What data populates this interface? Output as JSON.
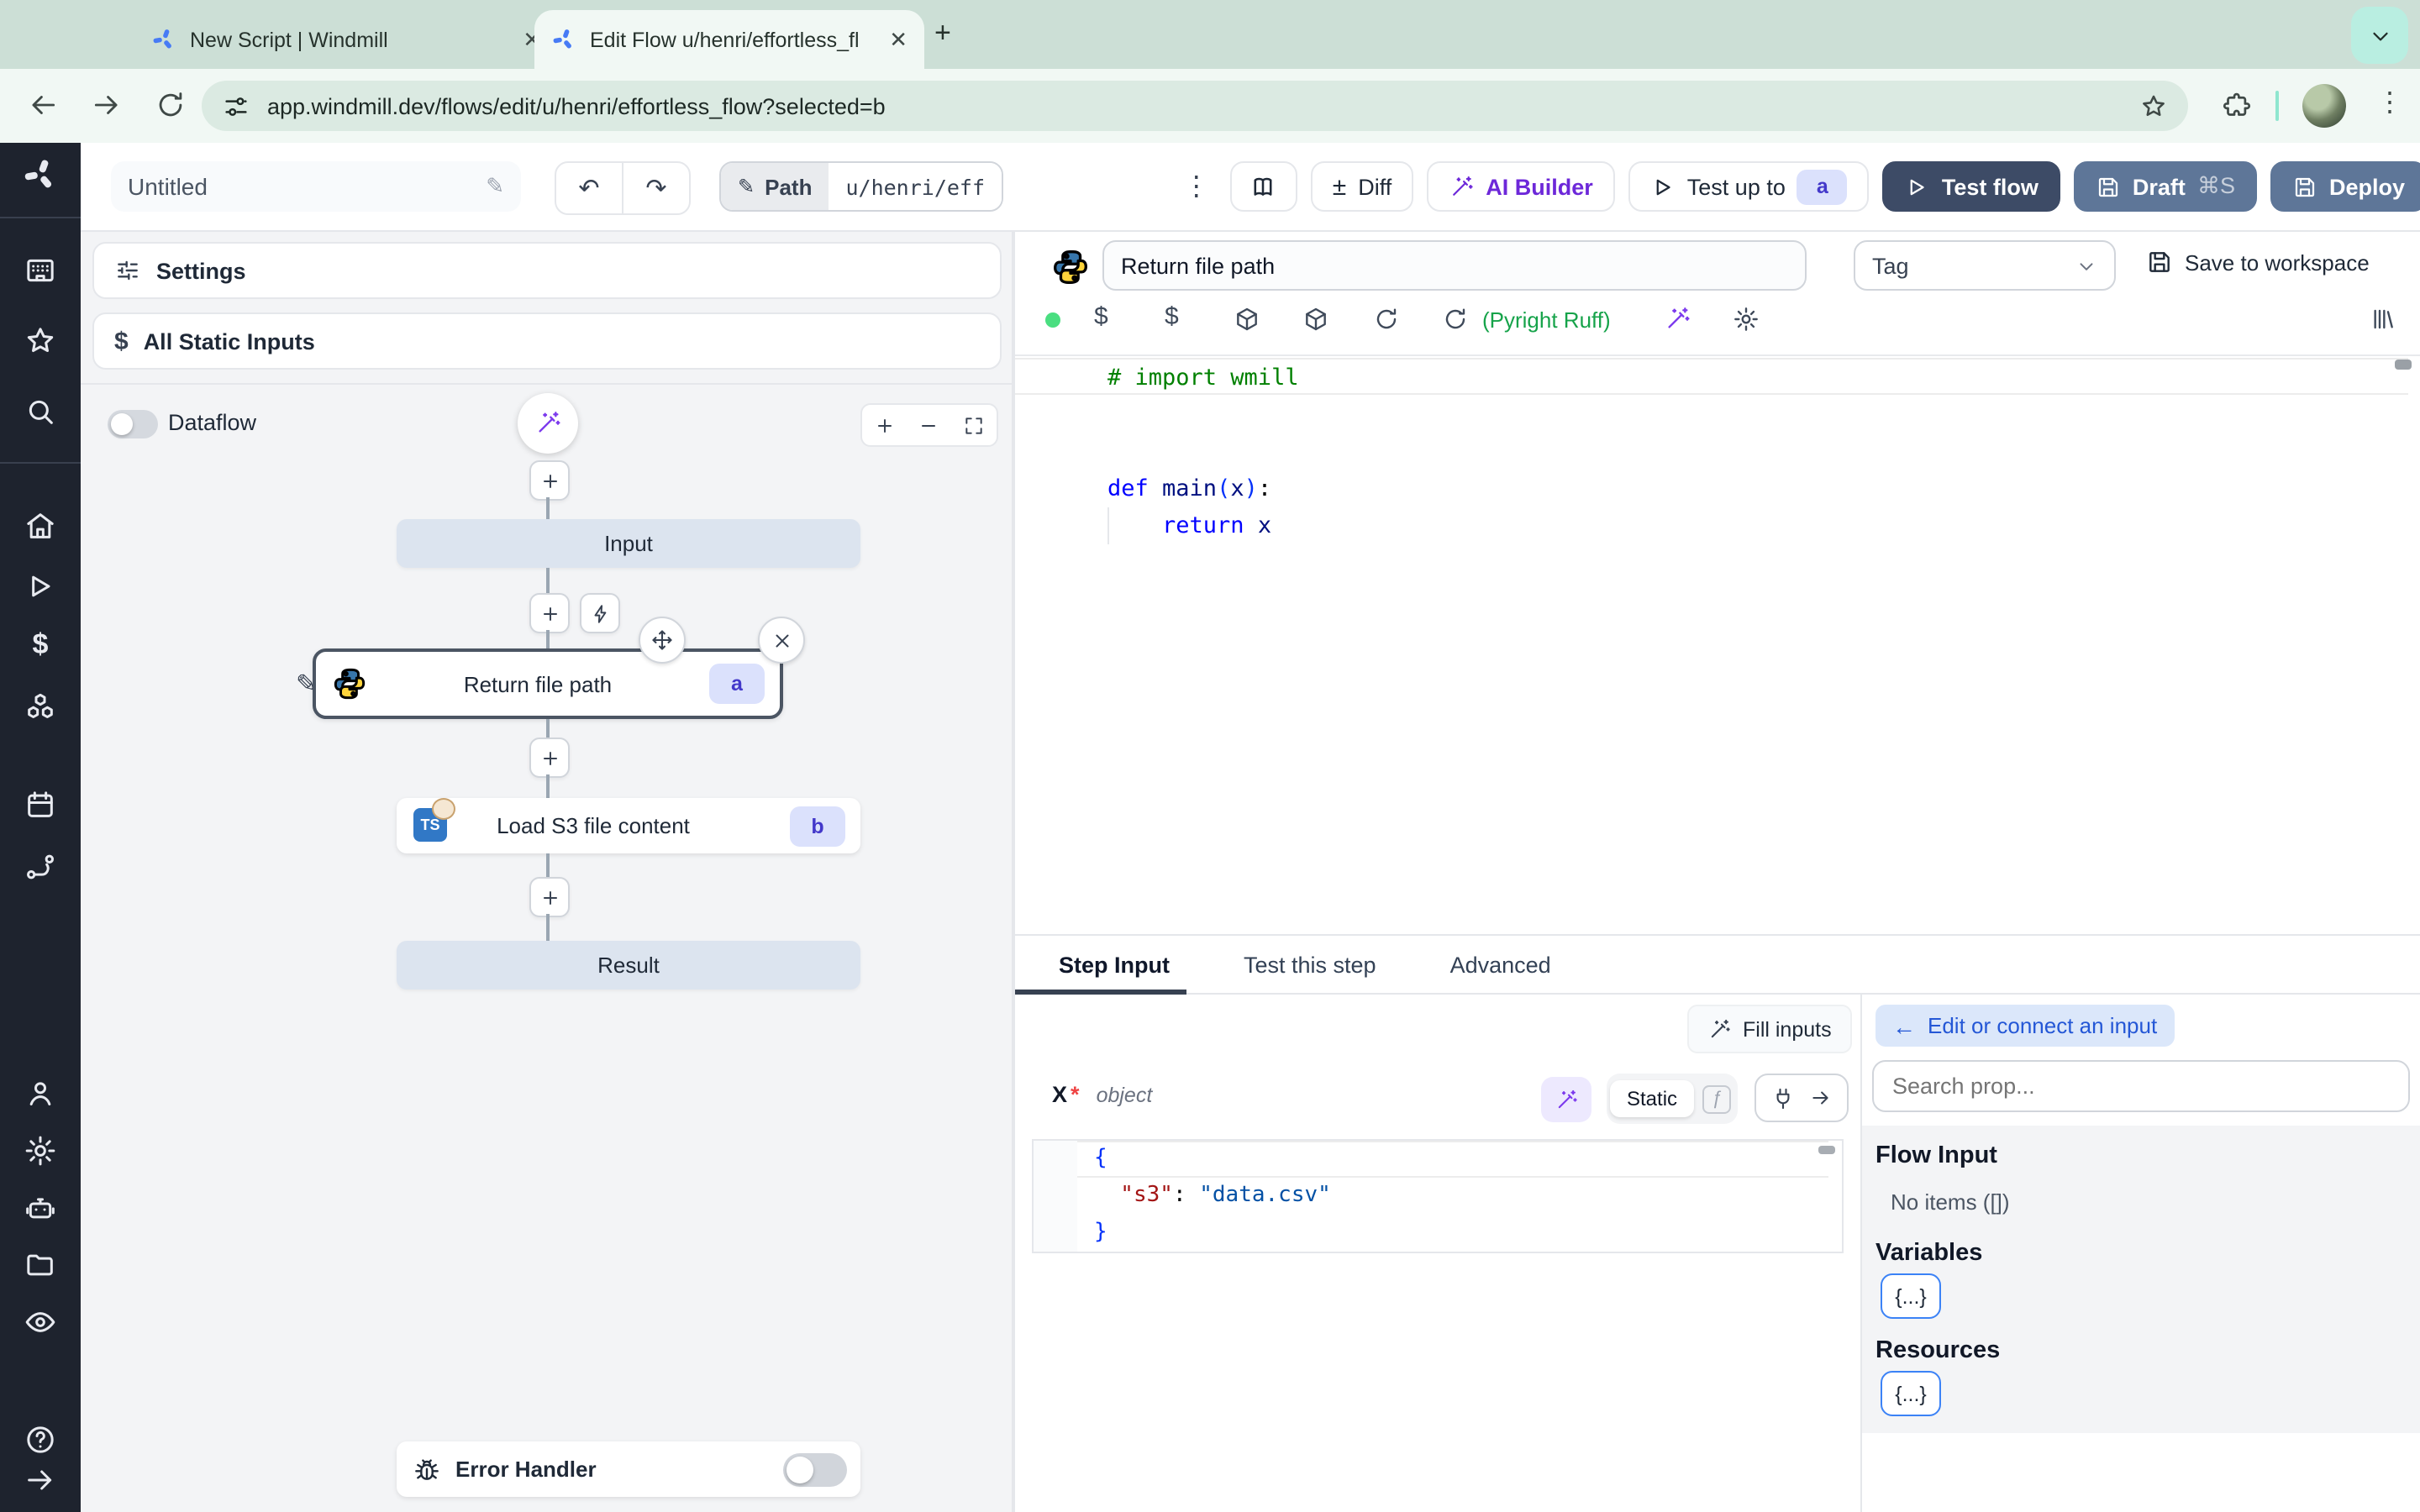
{
  "browser": {
    "tab1_title": "New Script | Windmill",
    "tab2_title": "Edit Flow u/henri/effortless_fl",
    "url": "app.windmill.dev/flows/edit/u/henri/effortless_flow?selected=b"
  },
  "toolbar": {
    "flow_name": "Untitled",
    "path_label": "Path",
    "path_value": "u/henri/eff",
    "diff_label": "Diff",
    "plusminus": "±",
    "ai_builder_label": "AI Builder",
    "test_up_to_label": "Test up to",
    "test_up_to_badge": "a",
    "test_flow_label": "Test flow",
    "draft_label": "Draft",
    "draft_shortcut": "⌘S",
    "deploy_label": "Deploy",
    "kebab": "⋮",
    "undo": "↶",
    "redo": "↷",
    "pencil": "✎"
  },
  "flow_panel": {
    "settings_label": "Settings",
    "all_static_inputs_label": "All Static Inputs",
    "static_dollar": "$",
    "dataflow_label": "Dataflow",
    "error_handler_label": "Error Handler",
    "graph": {
      "input_label": "Input",
      "result_label": "Result",
      "step_a_title": "Return file path",
      "step_a_badge": "a",
      "step_b_title": "Load S3 file content",
      "step_b_badge": "b",
      "ts_logo": "TS",
      "pencil": "✎"
    }
  },
  "step_editor": {
    "name_value": "Return file path",
    "tag_label": "Tag",
    "save_label": "Save to workspace",
    "lint_label": "(Pyright Ruff)",
    "dollar1": "$",
    "dollar2": "$",
    "code": {
      "l1_comment": "# import wmill",
      "l4_kw": "def",
      "l4_fn": " main",
      "l4_p1": "(",
      "l4_arg": "x",
      "l4_p2": ")",
      "l4_colon": ":",
      "l5_kw": "    return",
      "l5_arg": " x"
    }
  },
  "subtabs": {
    "step_input": "Step Input",
    "test_this_step": "Test this step",
    "advanced": "Advanced"
  },
  "step_input": {
    "fill_inputs_label": "Fill inputs",
    "arg_name": "X",
    "required_mark": "*",
    "arg_type": "object",
    "static_label": "Static",
    "fx_glyph": "ƒ",
    "json": {
      "open": "{",
      "key": "  \"s3\"",
      "colon": ": ",
      "value": "\"data.csv\"",
      "close": "}"
    }
  },
  "connect_panel": {
    "back_arrow": "←",
    "edit_label": "Edit or connect an input",
    "search_placeholder": "Search prop...",
    "flow_input_label": "Flow Input",
    "no_items_label": "No items ([])",
    "variables_label": "Variables",
    "resources_label": "Resources",
    "variables_braces": "{...}",
    "resources_braces": "{...}"
  },
  "colors": {
    "accent_blue": "#2457d6",
    "brand_purple": "#7c3aed",
    "lint_green": "#16a34a",
    "dark_button": "#3d4b66",
    "slate_button": "#5e7698",
    "badge_bg": "#dbe1fc",
    "badge_text": "#4338ca",
    "chrome_sage": "#ccdfd6"
  }
}
